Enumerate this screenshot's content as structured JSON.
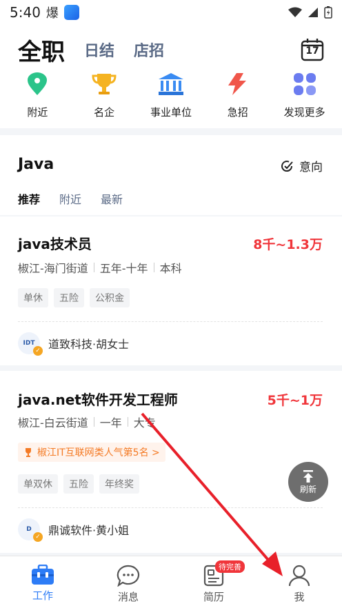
{
  "status": {
    "time": "5:40",
    "burn_glyph": "爆"
  },
  "header": {
    "main_tab": "全职",
    "tabs": [
      "日结",
      "店招"
    ],
    "calendar_day": "17"
  },
  "categories": [
    {
      "label": "附近",
      "icon": "location-pin-icon",
      "color": "#2bc48a"
    },
    {
      "label": "名企",
      "icon": "trophy-icon",
      "color": "#f5b321"
    },
    {
      "label": "事业单位",
      "icon": "institution-icon",
      "color": "#3a8bf2"
    },
    {
      "label": "急招",
      "icon": "lightning-icon",
      "color": "#f0564a"
    },
    {
      "label": "发现更多",
      "icon": "grid-more-icon",
      "color": "#6b7cf0"
    }
  ],
  "section": {
    "title": "Java",
    "intent_label": "意向",
    "filters": [
      "推荐",
      "附近",
      "最新"
    ]
  },
  "jobs": [
    {
      "title": "java技术员",
      "salary": "8千~1.3万",
      "location": "椒江-海门街道",
      "experience": "五年-十年",
      "education": "本科",
      "tags": [
        "单休",
        "五险",
        "公积金"
      ],
      "company": "道致科技·胡女士",
      "logo_text": "IDT"
    },
    {
      "title": "java.net软件开发工程师",
      "salary": "5千~1万",
      "location": "椒江-白云街道",
      "experience": "一年",
      "education": "大专",
      "rank": "椒江IT互联网类人气第5名 >",
      "tags": [
        "单双休",
        "五险",
        "年终奖"
      ],
      "company": "鼎诚软件·黄小姐",
      "logo_text": "D"
    }
  ],
  "refresh_label": "刷新",
  "tabbar": [
    {
      "label": "工作",
      "icon": "briefcase-icon",
      "active": true
    },
    {
      "label": "消息",
      "icon": "chat-icon",
      "active": false
    },
    {
      "label": "简历",
      "icon": "resume-icon",
      "active": false,
      "badge": "待完善"
    },
    {
      "label": "我",
      "icon": "person-icon",
      "active": false
    }
  ],
  "colors": {
    "accent": "#2d7cf6",
    "salary": "#f0353a",
    "annotation_arrow": "#e8202a"
  }
}
